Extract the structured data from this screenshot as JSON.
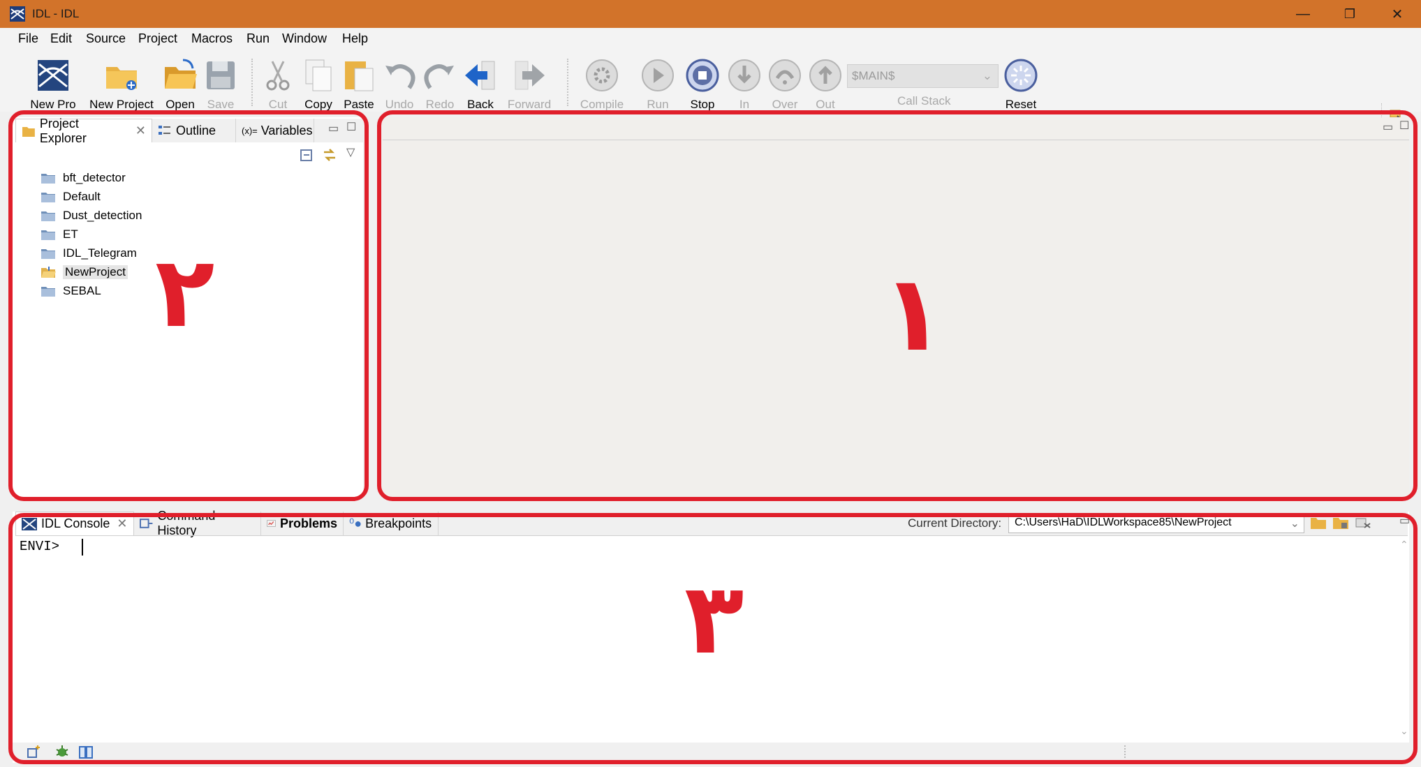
{
  "window": {
    "title": "IDL - IDL",
    "minimize": "—",
    "restore": "❐",
    "close": "✕"
  },
  "menu": [
    "File",
    "Edit",
    "Source",
    "Project",
    "Macros",
    "Run",
    "Window",
    "Help"
  ],
  "toolbar": {
    "new_pro": "New Pro",
    "new_project": "New Project",
    "open": "Open",
    "save": "Save",
    "cut": "Cut",
    "copy": "Copy",
    "paste": "Paste",
    "undo": "Undo",
    "redo": "Redo",
    "back": "Back",
    "forward": "Forward",
    "compile": "Compile",
    "run": "Run",
    "stop": "Stop",
    "step_in": "In",
    "step_over": "Over",
    "step_out": "Out",
    "call_stack_value": "$MAIN$",
    "call_stack_label": "Call Stack",
    "reset": "Reset"
  },
  "left_panel": {
    "tabs": [
      "Project Explorer",
      "Outline",
      "Variables"
    ],
    "projects": [
      "bft_detector",
      "Default",
      "Dust_detection",
      "ET",
      "IDL_Telegram",
      "NewProject",
      "SEBAL"
    ],
    "selected_project": "NewProject"
  },
  "console": {
    "tabs": [
      "IDL Console",
      "Command History",
      "Problems",
      "Breakpoints"
    ],
    "current_directory_label": "Current Directory:",
    "current_directory": "C:\\Users\\HaD\\IDLWorkspace85\\NewProject",
    "prompt": "ENVI>"
  },
  "annotations": {
    "editor": "١",
    "project_explorer": "٢",
    "console": "٣"
  },
  "colors": {
    "titlebar": "#d2732a",
    "highlight": "#e01f2b"
  }
}
